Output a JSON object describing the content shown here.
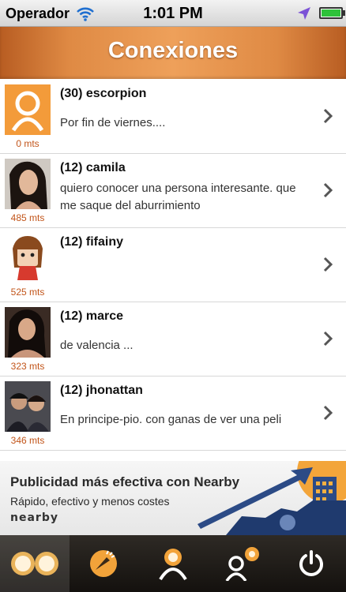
{
  "status_bar": {
    "carrier": "Operador",
    "time": "1:01 PM"
  },
  "header": {
    "title": "Conexiones"
  },
  "connections": [
    {
      "name": "(30) escorpion",
      "message": "Por fin de viernes....",
      "distance": "0 mts"
    },
    {
      "name": "(12) camila",
      "message": "quiero conocer una persona interesante. que me saque del aburrimiento",
      "distance": "485 mts"
    },
    {
      "name": "(12) fifainy",
      "message": "",
      "distance": "525 mts"
    },
    {
      "name": "(12) marce",
      "message": "de valencia ...",
      "distance": "323 mts"
    },
    {
      "name": "(12) jhonattan",
      "message": "En principe-pio. con ganas de ver una peli",
      "distance": "346 mts"
    }
  ],
  "ad": {
    "title": "Publicidad más efectiva con Nearby",
    "subtitle": "Rápido, efectivo y menos costes",
    "logo_text": "nearby"
  },
  "tabs": [
    {
      "icon": "connections-icon",
      "active": true
    },
    {
      "icon": "broadcast-icon",
      "active": false
    },
    {
      "icon": "profile-icon",
      "active": false
    },
    {
      "icon": "people-nearby-icon",
      "active": false
    },
    {
      "icon": "power-icon",
      "active": false
    }
  ],
  "colors": {
    "accent": "#df8a44",
    "distance": "#c2551a",
    "tabbar": "#1e1a16"
  }
}
